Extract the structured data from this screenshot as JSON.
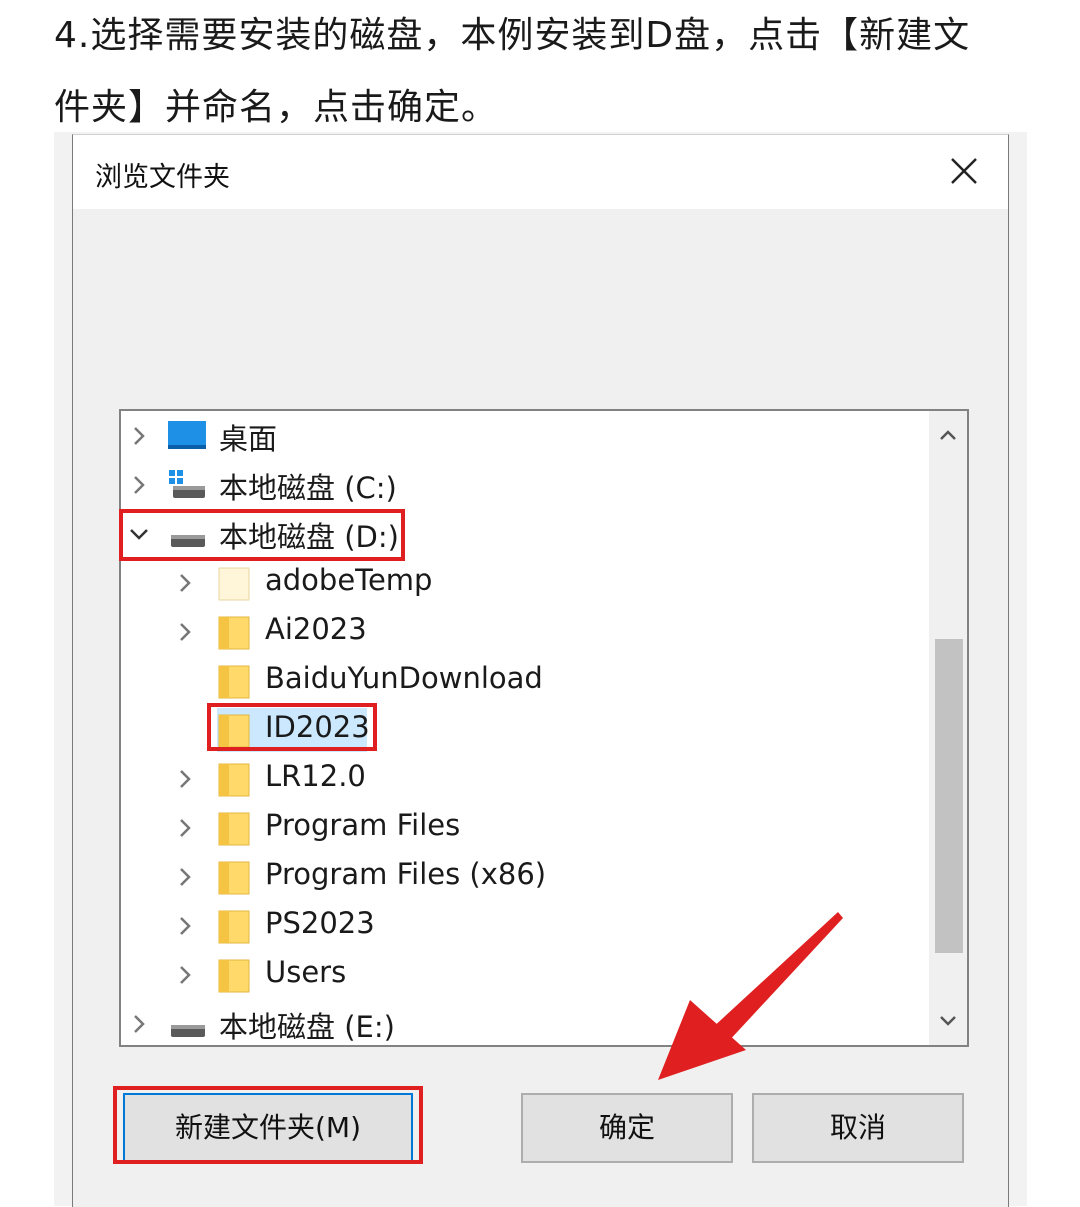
{
  "instruction": {
    "line1": "4.选择需要安装的磁盘，本例安装到D盘，点击【新建文",
    "line2": "件夹】并命名，点击确定。"
  },
  "dialog": {
    "title": "浏览文件夹",
    "close_icon": "close-icon"
  },
  "tree": {
    "items": [
      {
        "label": "桌面",
        "icon": "desktop-icon",
        "expanded": false
      },
      {
        "label": "本地磁盘 (C:)",
        "icon": "system-drive-icon",
        "expanded": false
      },
      {
        "label": "本地磁盘 (D:)",
        "icon": "drive-icon",
        "expanded": true
      },
      {
        "label": "adobeTemp",
        "icon": "folder-icon",
        "expanded": false
      },
      {
        "label": "Ai2023",
        "icon": "folder-icon",
        "expanded": false
      },
      {
        "label": "BaiduYunDownload",
        "icon": "folder-icon"
      },
      {
        "label": "ID2023",
        "icon": "folder-icon",
        "selected": true
      },
      {
        "label": "LR12.0",
        "icon": "folder-icon",
        "expanded": false
      },
      {
        "label": "Program Files",
        "icon": "folder-icon",
        "expanded": false
      },
      {
        "label": "Program Files (x86)",
        "icon": "folder-icon",
        "expanded": false
      },
      {
        "label": "PS2023",
        "icon": "folder-icon",
        "expanded": false
      },
      {
        "label": "Users",
        "icon": "folder-icon",
        "expanded": false
      },
      {
        "label": "本地磁盘 (E:)",
        "icon": "drive-icon",
        "expanded": false
      }
    ]
  },
  "buttons": {
    "new_folder": "新建文件夹(M)",
    "ok": "确定",
    "cancel": "取消"
  },
  "colors": {
    "highlight": "#e02020",
    "selection": "#cce8ff",
    "folder": "#ffd969"
  }
}
